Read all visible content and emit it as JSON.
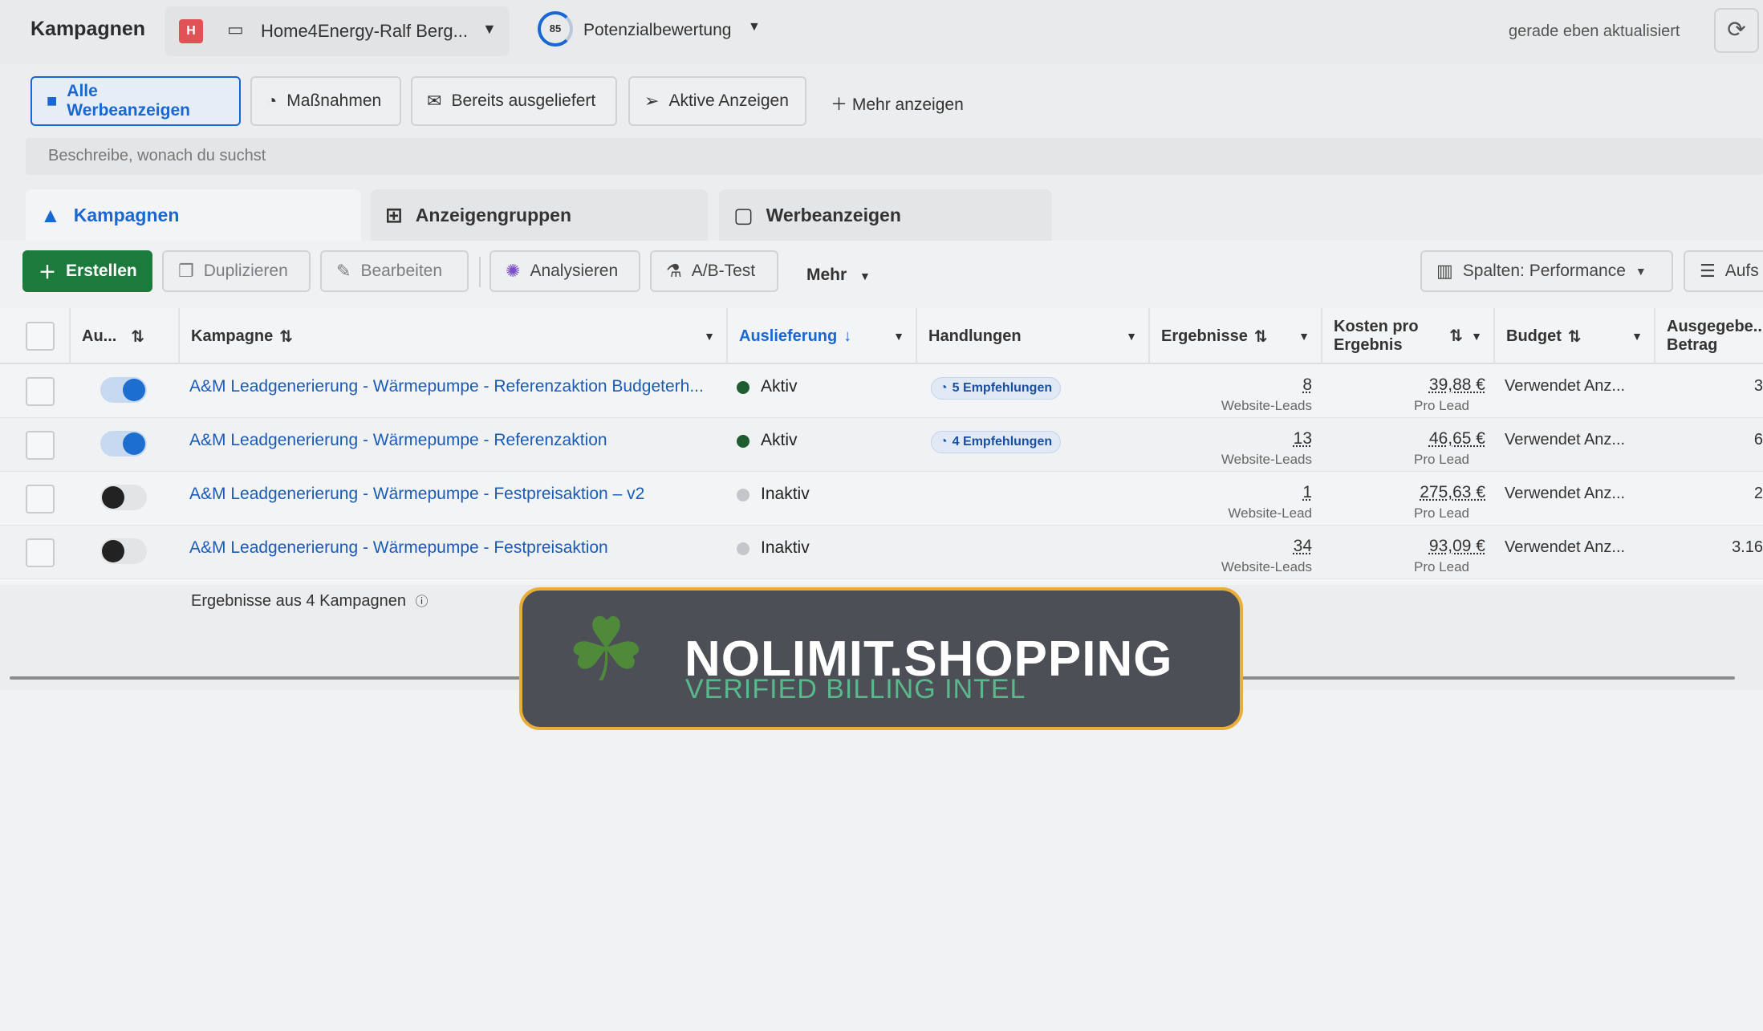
{
  "header": {
    "title": "Kampagnen",
    "account_badge": "H",
    "account_name": "Home4Energy-Ralf Berg...",
    "score_value": "85",
    "score_label": "Potenzialbewertung",
    "updated": "gerade eben aktualisiert"
  },
  "filters": {
    "chips": [
      "Alle Werbeanzeigen",
      "Maßnahmen",
      "Bereits ausgeliefert",
      "Aktive Anzeigen"
    ],
    "more": "Mehr anzeigen",
    "search_placeholder": "Beschreibe, wonach du suchst"
  },
  "tabs": [
    "Kampagnen",
    "Anzeigengruppen",
    "Werbeanzeigen"
  ],
  "toolbar": {
    "create": "Erstellen",
    "duplicate": "Duplizieren",
    "edit": "Bearbeiten",
    "analyze": "Analysieren",
    "ab_test": "A/B-Test",
    "more": "Mehr",
    "columns": "Spalten: Performance",
    "breakdown": "Aufs"
  },
  "table": {
    "headers": {
      "status": "Au...",
      "campaign": "Kampagne",
      "delivery": "Auslieferung",
      "actions": "Handlungen",
      "results": "Ergebnisse",
      "cost_line1": "Kosten pro",
      "cost_line2": "Ergebnis",
      "budget": "Budget",
      "spent_line1": "Ausgegebe...",
      "spent_line2": "Betrag"
    },
    "rows": [
      {
        "name": "A&M Leadgenerierung - Wärmepumpe - Referenzaktion Budgeterh...",
        "delivery": "Aktiv",
        "recommendations": "5 Empfehlungen",
        "results": "8",
        "results_unit": "Website-Leads",
        "cost": "39,88 €",
        "cost_unit": "Pro Lead",
        "budget": "Verwendet Anz...",
        "spent": "3"
      },
      {
        "name": "A&M Leadgenerierung - Wärmepumpe - Referenzaktion",
        "delivery": "Aktiv",
        "recommendations": "4 Empfehlungen",
        "results": "13",
        "results_unit": "Website-Leads",
        "cost": "46,65 €",
        "cost_unit": "Pro Lead",
        "budget": "Verwendet Anz...",
        "spent": "6"
      },
      {
        "name": "A&M Leadgenerierung - Wärmepumpe - Festpreisaktion – v2",
        "delivery": "Inaktiv",
        "recommendations": "",
        "results": "1",
        "results_unit": "Website-Lead",
        "cost": "275,63 €",
        "cost_unit": "Pro Lead",
        "budget": "Verwendet Anz...",
        "spent": "2"
      },
      {
        "name": "A&M Leadgenerierung - Wärmepumpe - Festpreisaktion",
        "delivery": "Inaktiv",
        "recommendations": "",
        "results": "34",
        "results_unit": "Website-Leads",
        "cost": "93,09 €",
        "cost_unit": "Pro Lead",
        "budget": "Verwendet Anz...",
        "spent": "3.16"
      }
    ],
    "summary": "Ergebnisse aus 4 Kampagnen"
  },
  "banner": {
    "title": "NOLIMIT.SHOPPING",
    "subtitle": "VERIFIED BILLING INTEL"
  },
  "colors": {
    "accent": "#1967d2",
    "create_green": "#1d7a3d",
    "active_dot": "#1f5c30",
    "inactive_dot": "#c4c6c9",
    "banner_border": "#e9ae3a"
  }
}
